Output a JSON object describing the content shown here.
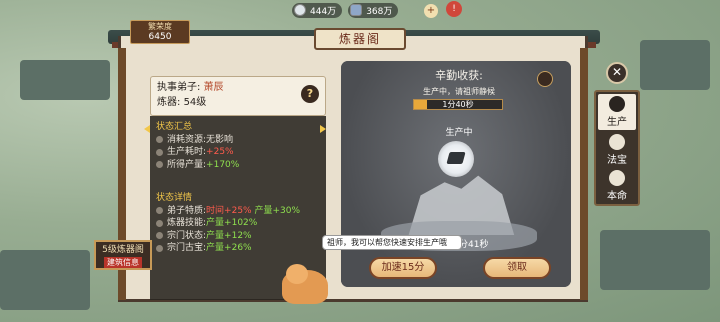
{
  "currencies": [
    {
      "name": "silver",
      "value": "444万"
    },
    {
      "name": "gem",
      "value": "368万"
    }
  ],
  "notice_count": "",
  "power": {
    "label": "繁荣度",
    "value": "6450"
  },
  "title": "炼器阁",
  "disciple": {
    "label": "执事弟子:",
    "name": "萧辰",
    "level_label": "炼器:",
    "level": "54级"
  },
  "status_summary": {
    "title": "状态汇总",
    "rows": [
      {
        "k": "消耗资源:",
        "v": "无影响",
        "c": ""
      },
      {
        "k": "生产耗时:",
        "v": "+25%",
        "c": "red"
      },
      {
        "k": "所得产量:",
        "v": "+170%",
        "c": "grn"
      }
    ]
  },
  "status_detail": {
    "title": "状态详情",
    "rows": [
      {
        "k": "弟子特质:",
        "v": "时间+25%",
        "v2": "产量+30%"
      },
      {
        "k": "炼器技能:",
        "v": "产量+102%",
        "v2": ""
      },
      {
        "k": "宗门状态:",
        "v": "产量+12%",
        "v2": ""
      },
      {
        "k": "宗门古宝:",
        "v": "产量+26%",
        "v2": ""
      }
    ]
  },
  "scene": {
    "title": "辛勤收获:",
    "sub": "生产中，请祖师静候",
    "progress": "1分40秒",
    "progress_value": 0.15,
    "producing": "生产中",
    "time_left": "分41秒"
  },
  "buttons": {
    "speedup": "加速15分",
    "collect": "领取"
  },
  "bubble": "祖师，我可以帮您快速安排生产哦",
  "tabs": [
    {
      "label": "生产",
      "icon": "cauldron-icon"
    },
    {
      "label": "法宝",
      "icon": "treasure-icon"
    },
    {
      "label": "本命",
      "icon": "swirl-icon"
    }
  ],
  "sign": {
    "title": "5级炼器阁",
    "sub": "建筑信息"
  },
  "colors": {
    "accent": "#e8a83a",
    "frame": "#4b3a2e",
    "paper": "#e9e0ce"
  }
}
